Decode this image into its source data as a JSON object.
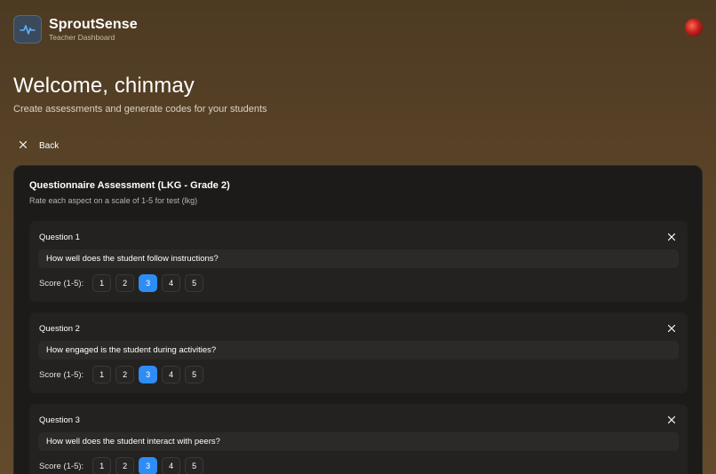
{
  "app": {
    "name": "SproutSense",
    "subtitle": "Teacher Dashboard"
  },
  "welcome": {
    "title": "Welcome, chinmay",
    "subtitle": "Create assessments and generate codes for your students"
  },
  "nav": {
    "back_label": "Back"
  },
  "assessment": {
    "title": "Questionnaire Assessment (LKG - Grade 2)",
    "subtitle": "Rate each aspect on a scale of 1-5 for test (lkg)",
    "score_label": "Score (1-5):",
    "score_options": [
      "1",
      "2",
      "3",
      "4",
      "5"
    ],
    "questions": [
      {
        "label": "Question 1",
        "text": "How well does the student follow instructions?",
        "selected_score": 3
      },
      {
        "label": "Question 2",
        "text": "How engaged is the student during activities?",
        "selected_score": 3
      },
      {
        "label": "Question 3",
        "text": "How well does the student interact with peers?",
        "selected_score": 3
      }
    ]
  },
  "colors": {
    "accent": "#2e8cf5",
    "card_bg": "#1c1b1a",
    "question_bg": "#232221",
    "page_bg_top": "#4d3a22",
    "page_bg_bottom": "#624a2b"
  },
  "icons": {
    "logo": "pulse-icon",
    "back": "close-icon",
    "question_remove": "close-icon"
  }
}
